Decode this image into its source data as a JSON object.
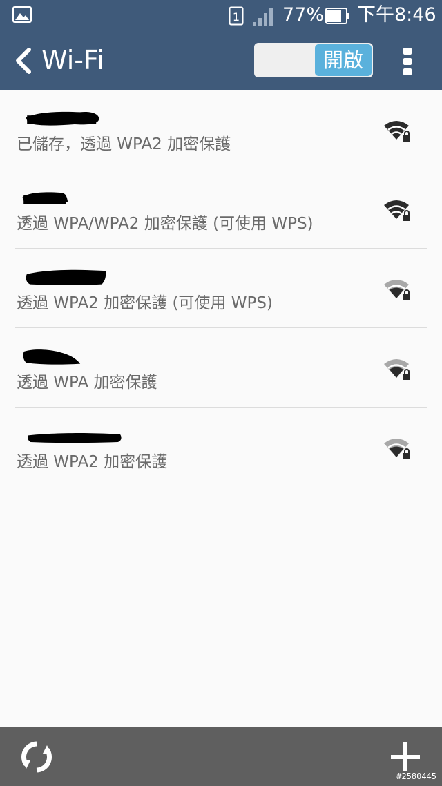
{
  "status_bar": {
    "icons": [
      "gallery-icon",
      "sim-icon",
      "signal-icon",
      "battery-icon"
    ],
    "battery_percent": "77%",
    "time": "下午8:46"
  },
  "header": {
    "title": "Wi-Fi",
    "toggle_label": "開啟"
  },
  "networks": [
    {
      "ssid": "",
      "security": "已儲存，透過 WPA2 加密保護",
      "signal": "strong",
      "secured": true
    },
    {
      "ssid": "",
      "security": "透過 WPA/WPA2 加密保護 (可使用 WPS)",
      "signal": "strong",
      "secured": true
    },
    {
      "ssid": "",
      "security": "透過 WPA2 加密保護 (可使用 WPS)",
      "signal": "medium",
      "secured": true
    },
    {
      "ssid": "",
      "security": "透過 WPA 加密保護",
      "signal": "medium",
      "secured": true
    },
    {
      "ssid": "",
      "security": "透過 WPA2 加密保護",
      "signal": "medium",
      "secured": true
    }
  ],
  "bottom_bar": {
    "icons": [
      "refresh-icon",
      "add-icon"
    ],
    "watermark": "#2580445"
  },
  "colors": {
    "primary": "#3f5a7a",
    "toggle_on": "#5ab1dc",
    "bottom_bar": "#5f5f5f",
    "secondary_text": "#6a6a6a"
  }
}
